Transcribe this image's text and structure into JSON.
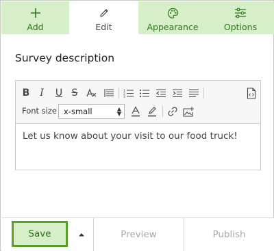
{
  "tabs": [
    {
      "label": "Add",
      "icon": "plus-icon"
    },
    {
      "label": "Edit",
      "icon": "pencil-icon"
    },
    {
      "label": "Appearance",
      "icon": "palette-icon"
    },
    {
      "label": "Options",
      "icon": "sliders-icon"
    }
  ],
  "active_tab": "Edit",
  "section": {
    "title": "Survey description"
  },
  "toolbar": {
    "font_size_label": "Font size",
    "font_size_value": "x-small",
    "buttons": [
      "bold-icon",
      "italic-icon",
      "underline-icon",
      "strikethrough-icon",
      "clear-format-icon",
      "align-icon",
      "numbered-list-icon",
      "bulleted-list-icon",
      "outdent-icon",
      "indent-icon",
      "justify-icon",
      "source-code-icon",
      "font-color-icon",
      "highlight-icon",
      "link-icon",
      "image-icon"
    ]
  },
  "editor": {
    "content": "Let us know about your visit to our food truck!"
  },
  "footer": {
    "save_label": "Save",
    "preview_label": "Preview",
    "publish_label": "Publish"
  },
  "colors": {
    "tab_bg": "#d7efc9",
    "accent_green": "#5aa028",
    "tab_text": "#2a7a14",
    "disabled_text": "#a8a8a8"
  }
}
